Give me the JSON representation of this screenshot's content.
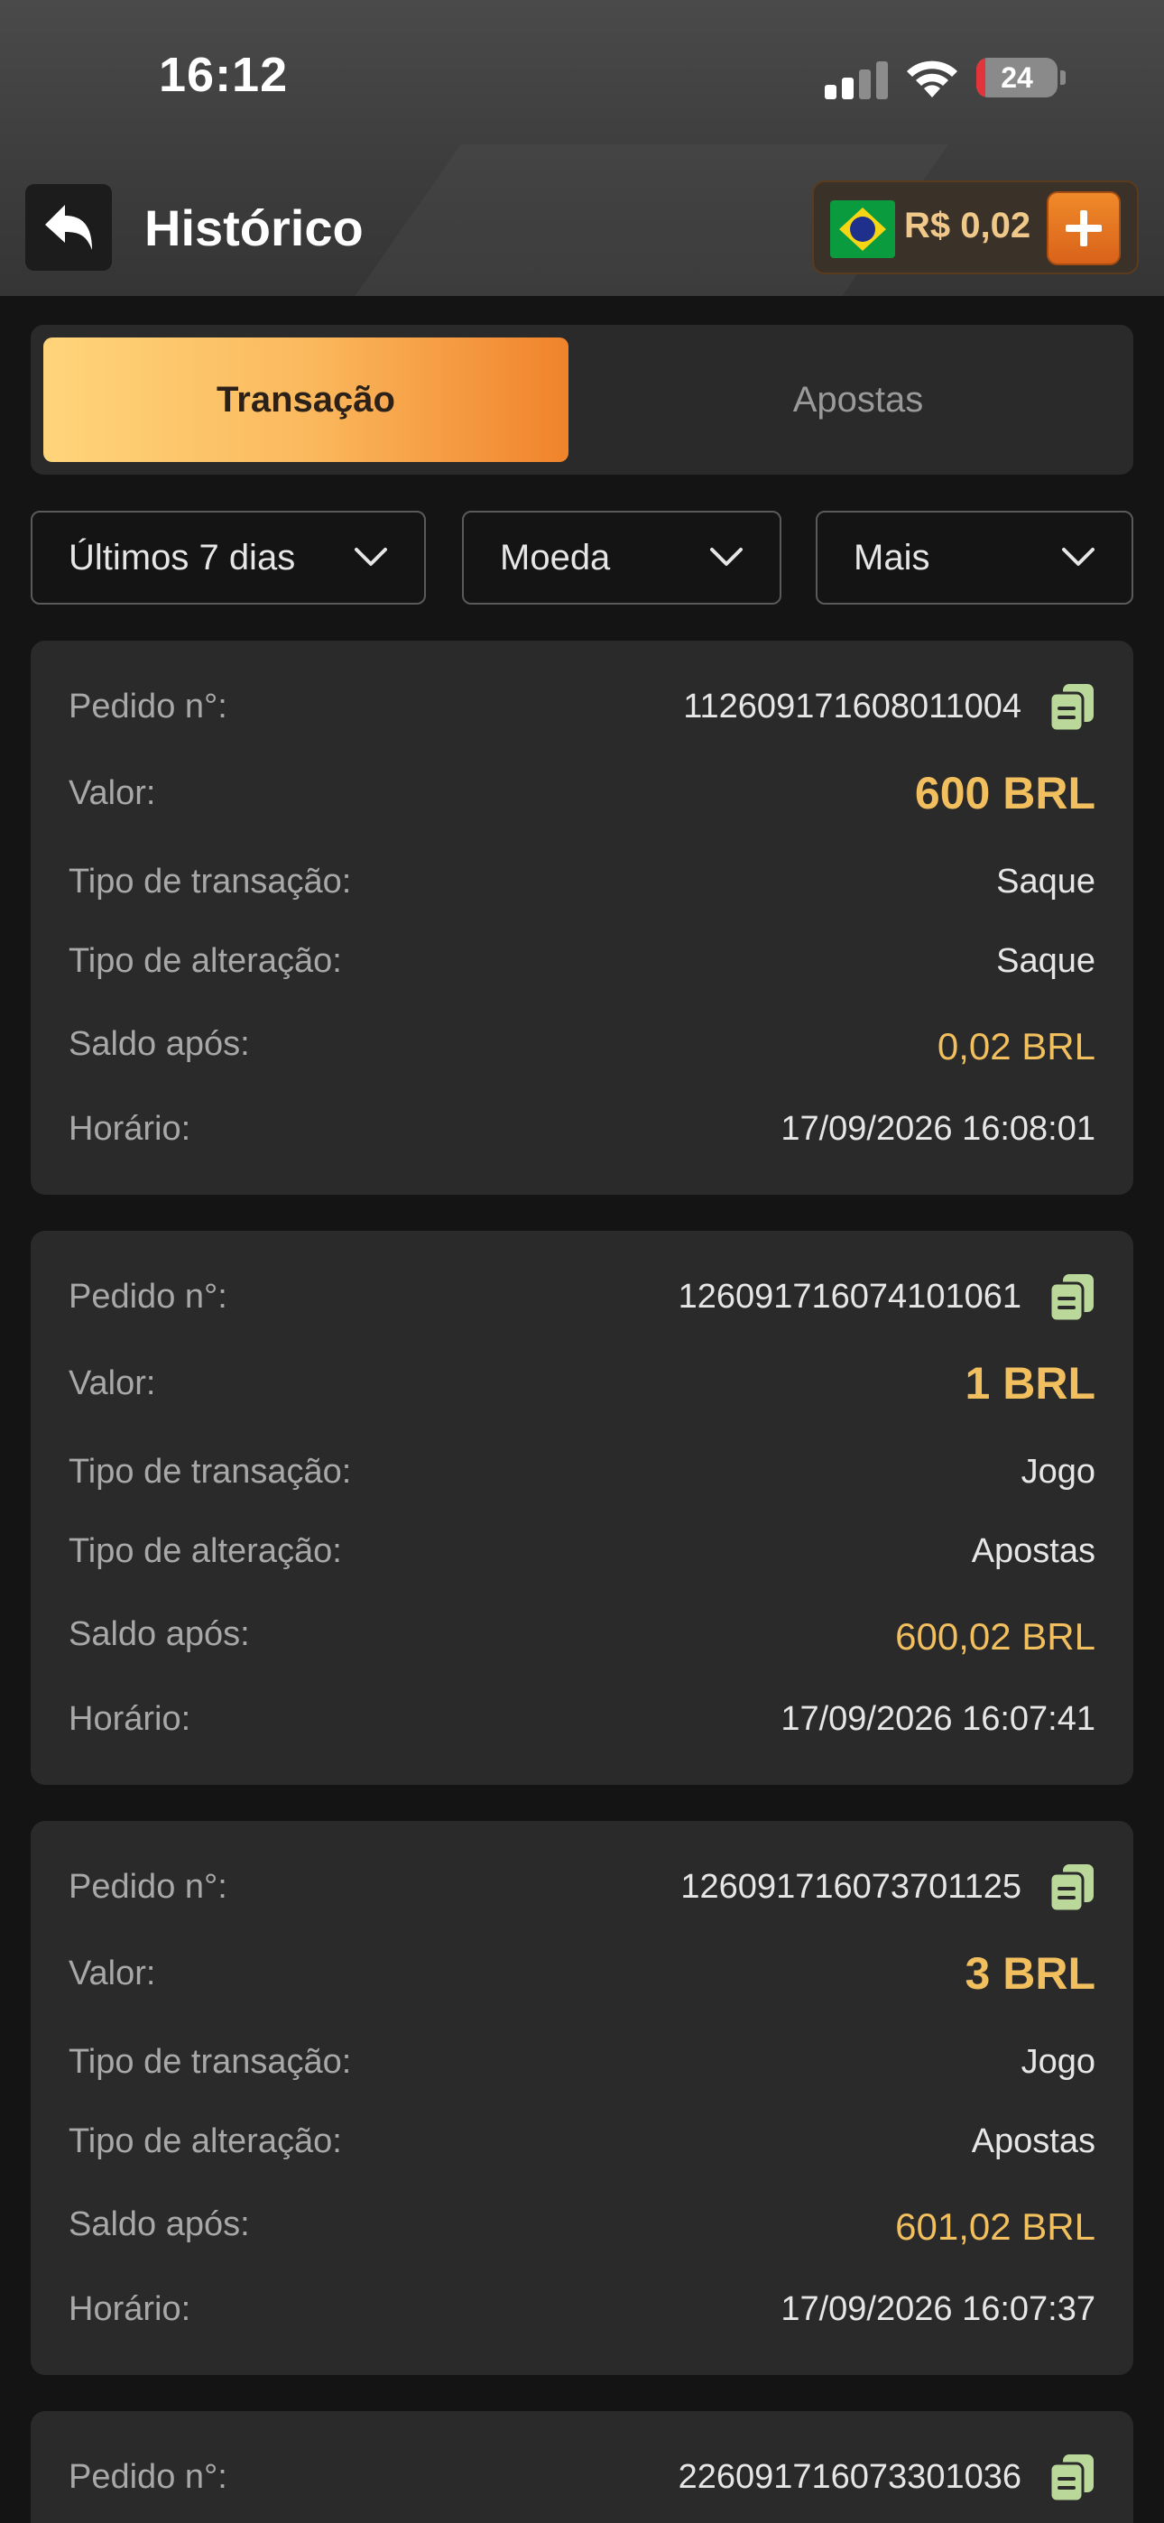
{
  "status_bar": {
    "time": "16:12",
    "battery": "24"
  },
  "header": {
    "title": "Histórico",
    "balance": "R$ 0,02"
  },
  "tabs": [
    {
      "label": "Transação",
      "active": true
    },
    {
      "label": "Apostas",
      "active": false
    }
  ],
  "filters": [
    {
      "label": "Últimos 7 dias"
    },
    {
      "label": "Moeda"
    },
    {
      "label": "Mais"
    }
  ],
  "labels": {
    "order": "Pedido n°:",
    "value": "Valor:",
    "transaction_type": "Tipo de transação:",
    "change_type": "Tipo de alteração:",
    "balance_after": "Saldo após:",
    "time": "Horário:"
  },
  "transactions": [
    {
      "order": "112609171608011004",
      "value": "600 BRL",
      "transaction_type": "Saque",
      "change_type": "Saque",
      "balance_after": "0,02 BRL",
      "time": "17/09/2026 16:08:01"
    },
    {
      "order": "126091716074101061",
      "value": "1 BRL",
      "transaction_type": "Jogo",
      "change_type": "Apostas",
      "balance_after": "600,02 BRL",
      "time": "17/09/2026 16:07:41"
    },
    {
      "order": "126091716073701125",
      "value": "3 BRL",
      "transaction_type": "Jogo",
      "change_type": "Apostas",
      "balance_after": "601,02 BRL",
      "time": "17/09/2026 16:07:37"
    },
    {
      "order": "226091716073301036"
    }
  ],
  "colors": {
    "accent": "#f2bf5e",
    "tab_gradient_start": "#ffd57a",
    "tab_gradient_end": "#f0832b",
    "copy_icon": "#b9d89a"
  },
  "icons": {
    "back": "back-arrow-icon",
    "add": "plus-icon",
    "copy": "copy-icon",
    "dropdown": "chevron-down-icon"
  }
}
